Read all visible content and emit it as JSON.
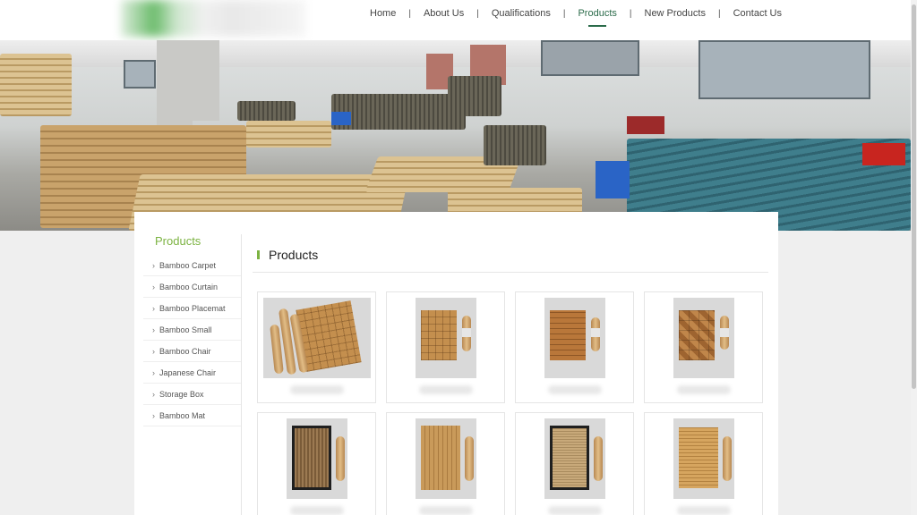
{
  "nav": {
    "items": [
      {
        "label": "Home",
        "active": false
      },
      {
        "label": "About Us",
        "active": false
      },
      {
        "label": "Qualifications",
        "active": false
      },
      {
        "label": "Products",
        "active": true
      },
      {
        "label": "New Products",
        "active": false
      },
      {
        "label": "Contact Us",
        "active": false
      }
    ],
    "separator": "|"
  },
  "banner": {
    "slide_count": 2,
    "active_slide": 1
  },
  "sidebar": {
    "title": "Products",
    "items": [
      {
        "label": "Bamboo Carpet"
      },
      {
        "label": "Bamboo Curtain"
      },
      {
        "label": "Bamboo Placemat"
      },
      {
        "label": "Bamboo Small"
      },
      {
        "label": "Bamboo Chair"
      },
      {
        "label": "Japanese Chair"
      },
      {
        "label": "Storage Box"
      },
      {
        "label": "Bamboo Mat"
      }
    ],
    "chevron": "›"
  },
  "main": {
    "title": "Products"
  },
  "colors": {
    "accent_green": "#7cb342",
    "nav_active": "#2b6b4a",
    "slide_dot_active": "#e02020"
  },
  "icons": {
    "sidebar_chevron": "chevron-right-icon"
  }
}
